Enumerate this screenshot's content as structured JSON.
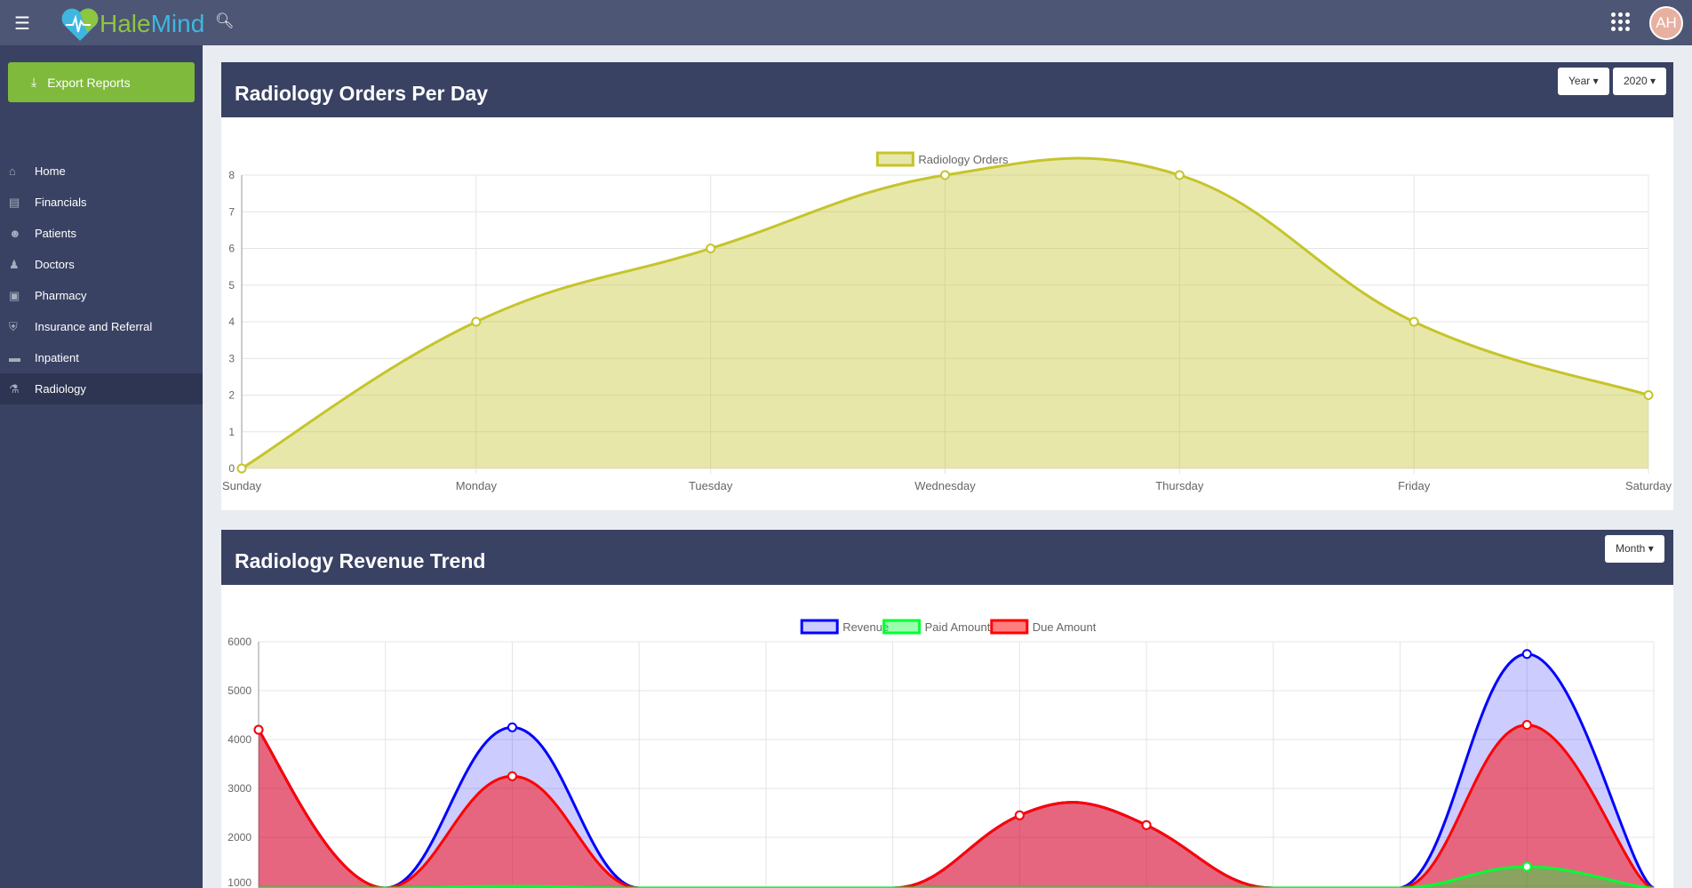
{
  "app": {
    "name_part1": "Hale",
    "name_part2": "Mind",
    "avatar_initials": "AH"
  },
  "sidebar": {
    "export_label": "Export Reports",
    "items": [
      {
        "label": "Home",
        "icon": "home-icon"
      },
      {
        "label": "Financials",
        "icon": "money-icon"
      },
      {
        "label": "Patients",
        "icon": "users-icon"
      },
      {
        "label": "Doctors",
        "icon": "doctor-icon"
      },
      {
        "label": "Pharmacy",
        "icon": "medkit-icon"
      },
      {
        "label": "Insurance and Referral",
        "icon": "shield-icon"
      },
      {
        "label": "Inpatient",
        "icon": "bed-icon"
      },
      {
        "label": "Radiology",
        "icon": "microscope-icon",
        "active": true
      }
    ]
  },
  "card1": {
    "title": "Radiology Orders Per Day",
    "filter1": "Year",
    "filter2": "2020"
  },
  "card2": {
    "title": "Radiology Revenue Trend",
    "filter1": "Month"
  },
  "chart_data": [
    {
      "type": "area",
      "categories": [
        "Sunday",
        "Monday",
        "Tuesday",
        "Wednesday",
        "Thursday",
        "Friday",
        "Saturday"
      ],
      "series": [
        {
          "name": "Radiology Orders",
          "values": [
            0,
            4,
            6,
            8,
            8,
            4,
            2
          ],
          "color": "#c5c42b"
        }
      ],
      "ylim": [
        0,
        8
      ],
      "yticks": [
        0,
        1,
        2,
        3,
        4,
        5,
        6,
        7,
        8
      ],
      "legend": "top",
      "grid": true
    },
    {
      "type": "area",
      "categories": [
        "",
        "",
        "",
        "",
        "",
        "",
        "",
        "",
        "",
        "",
        "",
        ""
      ],
      "series": [
        {
          "name": "Revenue",
          "values": [
            4200,
            0,
            4250,
            0,
            0,
            0,
            2450,
            2250,
            0,
            0,
            5750,
            0
          ],
          "color": "#0000ff"
        },
        {
          "name": "Paid Amount",
          "values": [
            0,
            0,
            1000,
            0,
            0,
            0,
            0,
            0,
            0,
            0,
            1400,
            0
          ],
          "color": "#00ff33"
        },
        {
          "name": "Due Amount",
          "values": [
            4200,
            0,
            3250,
            0,
            0,
            0,
            2450,
            2250,
            0,
            0,
            4300,
            0
          ],
          "color": "#ff0000"
        }
      ],
      "ylim": [
        0,
        6000
      ],
      "yticks": [
        1000,
        2000,
        3000,
        4000,
        5000,
        6000
      ],
      "legend": "top",
      "grid": true
    }
  ]
}
